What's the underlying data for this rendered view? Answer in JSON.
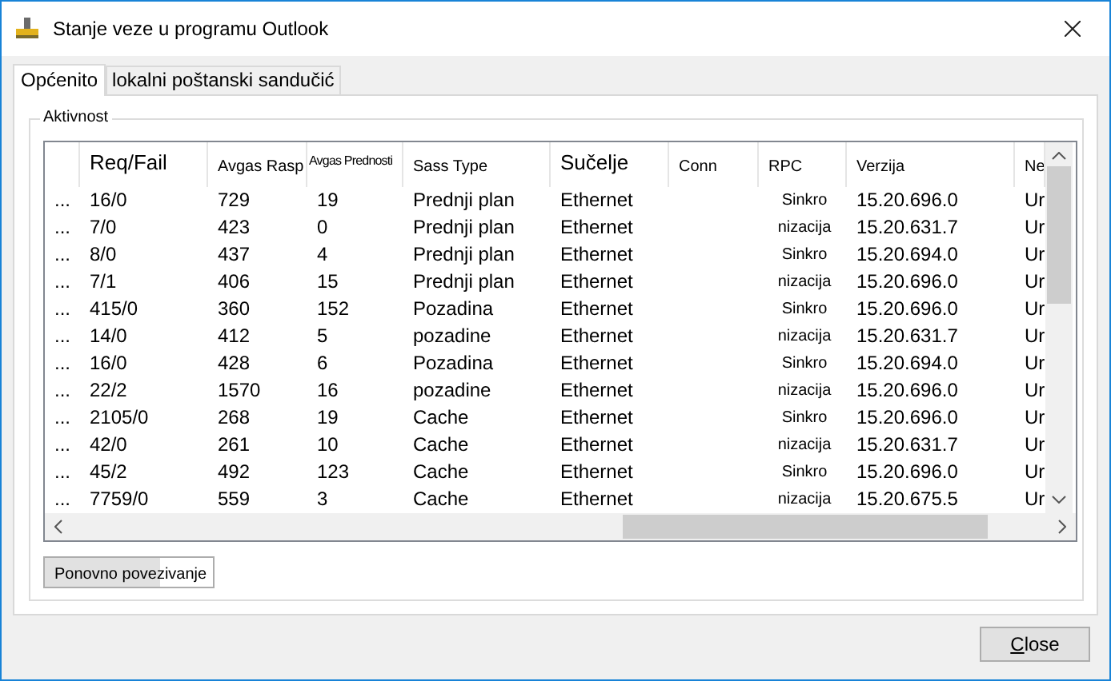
{
  "window": {
    "title": "Stanje veze u programu Outlook"
  },
  "tabs": [
    {
      "label": "Općenito",
      "selected": true
    },
    {
      "label": "lokalni poštanski sandučić",
      "selected": false
    }
  ],
  "group": {
    "title": "Aktivnost"
  },
  "table": {
    "columns": [
      {
        "kind": "normal"
      },
      {
        "label": "Req/Fail",
        "kind": "large"
      },
      {
        "label": "Avgas Rasp",
        "kind": "normal"
      },
      {
        "label": "Avgas Prednosti",
        "kind": "tiny"
      },
      {
        "label": "Sass Type",
        "kind": "normal"
      },
      {
        "label": "Sučelje",
        "kind": "large"
      },
      {
        "label": "Conn",
        "kind": "normal"
      },
      {
        "label": "RPC",
        "kind": "normal"
      },
      {
        "label": "Verzija",
        "kind": "normal"
      },
      {
        "label": "Ne",
        "kind": "normal"
      }
    ],
    "rows": [
      {
        "cells": [
          "...",
          "16/0",
          "729",
          "19",
          "Prednji plan",
          "Ethernet",
          null,
          "Sinkro",
          "15.20.696.0",
          "Ur"
        ]
      },
      {
        "cells": [
          "...",
          "7/0",
          "423",
          "0",
          "Prednji plan",
          "Ethernet",
          null,
          "nizacija",
          "15.20.631.7",
          "Ur"
        ]
      },
      {
        "cells": [
          "...",
          "8/0",
          "437",
          "4",
          "Prednji plan",
          "Ethernet",
          null,
          "Sinkro",
          "15.20.694.0",
          "Ur"
        ]
      },
      {
        "cells": [
          "...",
          "7/1",
          "406",
          "15",
          "Prednji plan",
          "Ethernet",
          null,
          "nizacija",
          "15.20.696.0",
          "Ur"
        ]
      },
      {
        "cells": [
          "...",
          "415/0",
          "360",
          "152",
          "Pozadina",
          "Ethernet",
          null,
          "Sinkro",
          "15.20.696.0",
          "Ur"
        ]
      },
      {
        "cells": [
          "...",
          "14/0",
          "412",
          "5",
          "pozadine",
          "Ethernet",
          null,
          "nizacija",
          "15.20.631.7",
          "Ur"
        ]
      },
      {
        "cells": [
          "...",
          "16/0",
          "428",
          "6",
          "Pozadina",
          "Ethernet",
          null,
          "Sinkro",
          "15.20.694.0",
          "Ur"
        ]
      },
      {
        "cells": [
          "...",
          "22/2",
          "1570",
          "16",
          "pozadine",
          "Ethernet",
          null,
          "nizacija",
          "15.20.696.0",
          "Ur"
        ]
      },
      {
        "cells": [
          "...",
          "2105/0",
          "268",
          "19",
          "Cache",
          "Ethernet",
          null,
          "Sinkro",
          "15.20.696.0",
          "Ur"
        ]
      },
      {
        "cells": [
          "...",
          "42/0",
          "261",
          "10",
          "Cache",
          "Ethernet",
          null,
          "nizacija",
          "15.20.631.7",
          "Ur"
        ]
      },
      {
        "cells": [
          "...",
          "45/2",
          "492",
          "123",
          "Cache",
          "Ethernet",
          null,
          "Sinkro",
          "15.20.696.0",
          "Ur"
        ]
      },
      {
        "cells": [
          "...",
          "7759/0",
          "559",
          "3",
          "Cache",
          "Ethernet",
          null,
          "nizacija",
          "15.20.675.5",
          "Ur"
        ]
      }
    ]
  },
  "reconnect_button": {
    "label": "Ponovno povezivanje"
  },
  "close_button": {
    "label": "Close"
  }
}
